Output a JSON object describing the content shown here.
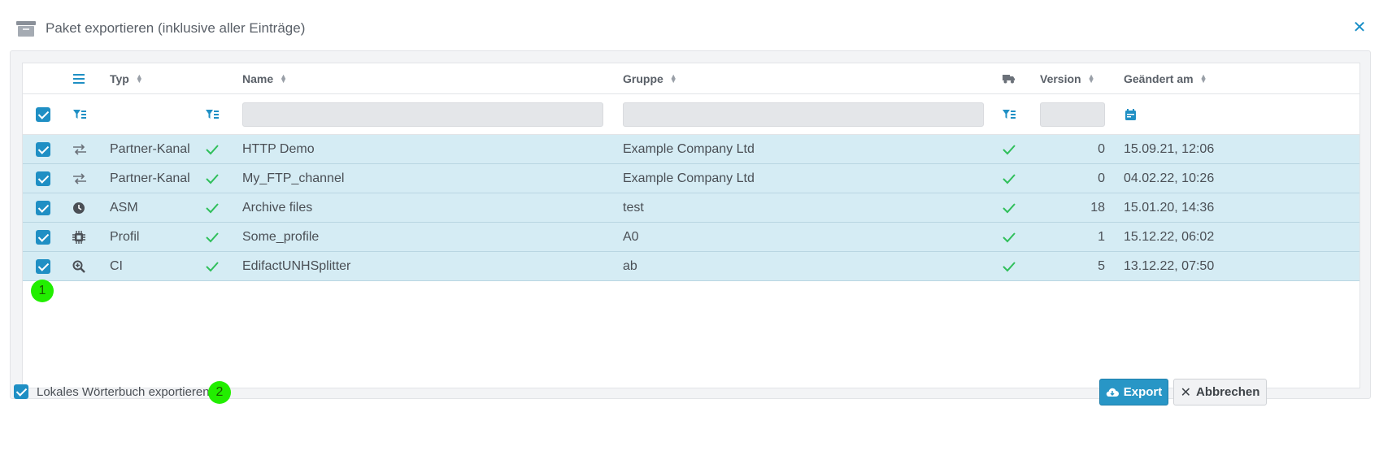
{
  "dialog": {
    "title": "Paket exportieren (inklusive aller Einträge)",
    "close_icon": "close-icon"
  },
  "table": {
    "headers": {
      "columns_menu_icon": "list-icon",
      "typ": "Typ",
      "name": "Name",
      "gruppe": "Gruppe",
      "truck_icon": "truck-icon",
      "version": "Version",
      "geaendert": "Geändert am"
    },
    "filters": {
      "name_value": "",
      "gruppe_value": "",
      "version_value": ""
    },
    "rows": [
      {
        "type_icon": "arrows-exchange-icon",
        "typ": "Partner-Kanal",
        "name": "HTTP Demo",
        "gruppe": "Example Company Ltd",
        "version": "0",
        "geaendert": "15.09.21, 12:06"
      },
      {
        "type_icon": "arrows-exchange-icon",
        "typ": "Partner-Kanal",
        "name": "My_FTP_channel",
        "gruppe": "Example Company Ltd",
        "version": "0",
        "geaendert": "04.02.22, 10:26"
      },
      {
        "type_icon": "clock-icon",
        "typ": "ASM",
        "name": "Archive files",
        "gruppe": "test",
        "version": "18",
        "geaendert": "15.01.20, 14:36"
      },
      {
        "type_icon": "chip-icon",
        "typ": "Profil",
        "name": "Some_profile",
        "gruppe": "A0",
        "version": "1",
        "geaendert": "15.12.22, 06:02"
      },
      {
        "type_icon": "magnifier-plus-icon",
        "typ": "CI",
        "name": "EdifactUNHSplitter",
        "gruppe": "ab",
        "version": "5",
        "geaendert": "13.12.22, 07:50"
      }
    ]
  },
  "annotations": {
    "badge1": "1",
    "badge2": "2"
  },
  "footer": {
    "dictionary_label": "Lokales Wörterbuch exportieren",
    "export_label": "Export",
    "cancel_label": "Abbrechen"
  },
  "colors": {
    "accent": "#1f8fc4",
    "row_selected": "#d5ecf4",
    "check_green": "#2fbf5a",
    "badge": "#22ee00"
  }
}
